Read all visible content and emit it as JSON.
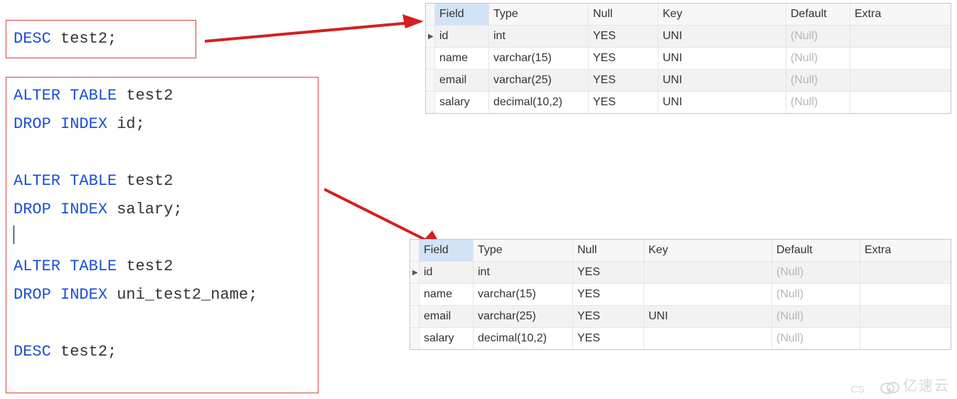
{
  "colors": {
    "keyword": "#1a4fd6",
    "box_border": "#d44545",
    "null_text": "#b6b6b6",
    "arrow": "#d32020",
    "header_hi": "#d2e3f5"
  },
  "code_box_1": {
    "tokens": [
      {
        "t": "DESC",
        "c": "kw"
      },
      {
        "t": " "
      },
      {
        "t": "test2;",
        "c": "ident"
      }
    ]
  },
  "code_box_2": {
    "l1": {
      "a": "ALTER",
      "b": "TABLE",
      "c": "test2"
    },
    "l2": {
      "a": "DROP",
      "b": "INDEX",
      "c": "id;"
    },
    "l4": {
      "a": "ALTER",
      "b": "TABLE",
      "c": "test2"
    },
    "l5": {
      "a": "DROP",
      "b": "INDEX",
      "c": "salary;"
    },
    "l7": {
      "a": "ALTER",
      "b": "TABLE",
      "c": "test2"
    },
    "l8": {
      "a": "DROP",
      "b": "INDEX",
      "c": "uni_test2_name;"
    },
    "l10": {
      "a": "DESC",
      "c": "test2;"
    }
  },
  "table_header": [
    "Field",
    "Type",
    "Null",
    "Key",
    "Default",
    "Extra"
  ],
  "table1": {
    "highlight_col": 0,
    "marker_row": 0,
    "rows": [
      {
        "Field": "id",
        "Type": "int",
        "Null": "YES",
        "Key": "UNI",
        "Default": "(Null)",
        "Extra": ""
      },
      {
        "Field": "name",
        "Type": "varchar(15)",
        "Null": "YES",
        "Key": "UNI",
        "Default": "(Null)",
        "Extra": ""
      },
      {
        "Field": "email",
        "Type": "varchar(25)",
        "Null": "YES",
        "Key": "UNI",
        "Default": "(Null)",
        "Extra": ""
      },
      {
        "Field": "salary",
        "Type": "decimal(10,2)",
        "Null": "YES",
        "Key": "UNI",
        "Default": "(Null)",
        "Extra": ""
      }
    ]
  },
  "table2": {
    "highlight_col": 0,
    "marker_row": 0,
    "rows": [
      {
        "Field": "id",
        "Type": "int",
        "Null": "YES",
        "Key": "",
        "Default": "(Null)",
        "Extra": ""
      },
      {
        "Field": "name",
        "Type": "varchar(15)",
        "Null": "YES",
        "Key": "",
        "Default": "(Null)",
        "Extra": ""
      },
      {
        "Field": "email",
        "Type": "varchar(25)",
        "Null": "YES",
        "Key": "UNI",
        "Default": "(Null)",
        "Extra": ""
      },
      {
        "Field": "salary",
        "Type": "decimal(10,2)",
        "Null": "YES",
        "Key": "",
        "Default": "(Null)",
        "Extra": ""
      }
    ]
  },
  "watermark_text": "亿速云",
  "cs_text": "CS"
}
